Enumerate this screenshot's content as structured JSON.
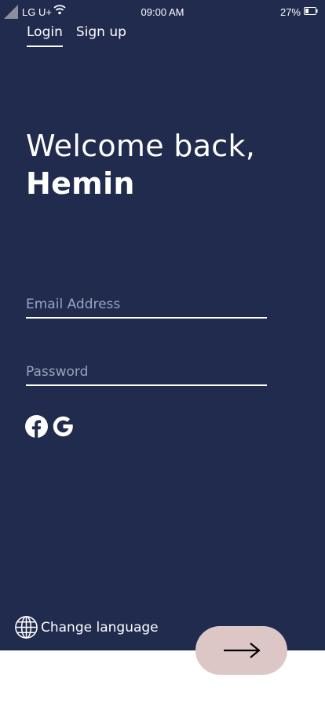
{
  "status_bar": {
    "carrier": "LG U+",
    "time": "09:00 AM",
    "battery": "27%"
  },
  "tabs": [
    {
      "label": "Login",
      "active": true
    },
    {
      "label": "Sign up",
      "active": false
    }
  ],
  "welcome": {
    "line1": "Welcome back,",
    "name": "Hemin"
  },
  "form": {
    "email_placeholder": "Email Address",
    "email_value": "",
    "password_placeholder": "Password",
    "password_value": ""
  },
  "social": {
    "icons": [
      "facebook-icon",
      "google-icon"
    ]
  },
  "language": {
    "label": "Change language",
    "icon": "globe-icon"
  },
  "next_button": {
    "icon": "arrow-right-icon"
  },
  "colors": {
    "background": "#202b4e",
    "accent": "#dcc7c6",
    "text": "#ffffff",
    "placeholder": "#9aa3bd"
  }
}
